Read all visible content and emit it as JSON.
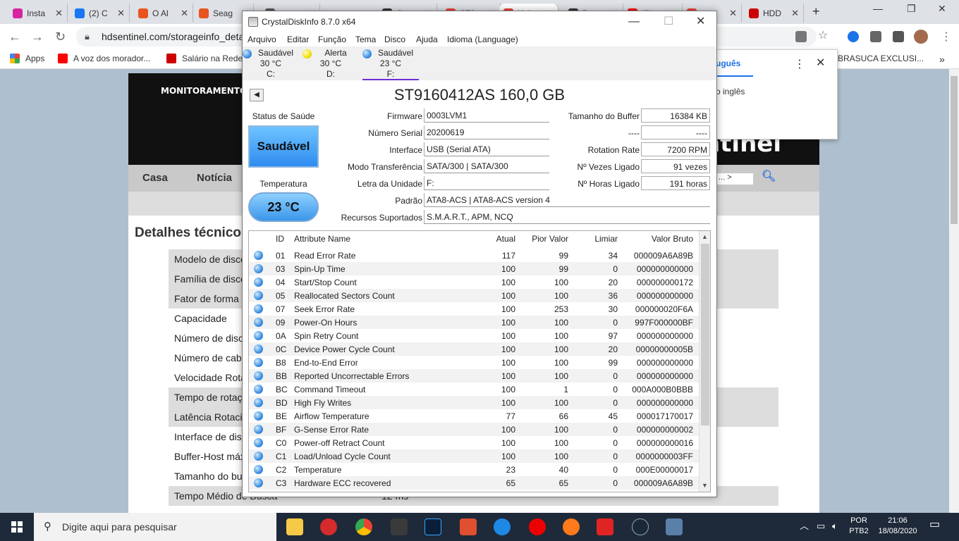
{
  "browser": {
    "tabs": [
      {
        "label": "Insta",
        "color": "#d6249f"
      },
      {
        "label": "(2) C",
        "color": "#1877f2"
      },
      {
        "label": "O Al",
        "color": "#e8541e"
      },
      {
        "label": "Seag",
        "color": "#e8541e"
      },
      {
        "label": "",
        "color": "#555"
      },
      {
        "label": "Ca",
        "color": "#333"
      },
      {
        "label": "ST9",
        "color": "#ea4335"
      },
      {
        "label": "Hel",
        "color": "#ea4335"
      },
      {
        "label": "Dat",
        "color": "#333"
      },
      {
        "label": "(3)",
        "color": "#ff0000"
      },
      {
        "label": "",
        "color": "#ea4335"
      },
      {
        "label": "HDD",
        "color": "#c00"
      }
    ],
    "url": "hdsentinel.com/storageinfo_deta",
    "bookmarks": [
      {
        "label": "Apps",
        "color": "#e94235"
      },
      {
        "label": "A voz dos morador...",
        "color": "#ff0000"
      },
      {
        "label": "Salário na Rede",
        "color": "#c00"
      },
      {
        "label": "BRASUCA EXCLUSI...",
        "color": "#fff"
      }
    ]
  },
  "translate": {
    "language": "uguês",
    "message": "o inglês"
  },
  "site": {
    "banner_title": "MONITORAMENTO DE",
    "brand": "ntinel",
    "menu": [
      "Casa",
      "Notícia"
    ],
    "search_hint": "... >",
    "heading": "Detalhes técnico",
    "details": [
      {
        "label": "Modelo de disco",
        "value": ""
      },
      {
        "label": "Família de disco",
        "value": ""
      },
      {
        "label": "Fator de forma",
        "value": ""
      },
      {
        "label": "Capacidade",
        "value": ""
      },
      {
        "label": "Número de disco",
        "value": ""
      },
      {
        "label": "Número de cabe",
        "value": ""
      },
      {
        "label": "Velocidade Rotac",
        "value": ""
      },
      {
        "label": "Tempo de rotaç",
        "value": ""
      },
      {
        "label": "Latência Rotacio",
        "value": ""
      },
      {
        "label": "Interface de disc",
        "value": ""
      },
      {
        "label": "Buffer-Host máx.",
        "value": ""
      },
      {
        "label": "Tamanho do buff",
        "value": ""
      },
      {
        "label": "Tempo Médio de Busca",
        "value": "12 ms"
      }
    ]
  },
  "cdi": {
    "title": "CrystalDiskInfo 8.7.0 x64",
    "menu": [
      "Arquivo",
      "Editar",
      "Função",
      "Tema",
      "Disco",
      "Ajuda",
      "Idioma (Language)"
    ],
    "disks": [
      {
        "status": "Saudável",
        "temp": "30 °C",
        "letter": "C:",
        "color": "blue"
      },
      {
        "status": "Alerta",
        "temp": "30 °C",
        "letter": "D:",
        "color": "yellow"
      },
      {
        "status": "Saudável",
        "temp": "23 °C",
        "letter": "F:",
        "color": "blue"
      }
    ],
    "model": "ST9160412AS 160,0 GB",
    "health_label": "Status de Saúde",
    "health": "Saudável",
    "temp_label": "Temperatura",
    "temp": "23 °C",
    "firmware_label": "Firmware",
    "firmware": "0003LVM1",
    "serial_label": "Número Serial",
    "serial": "20200619",
    "interface_label": "Interface",
    "interface": "USB (Serial ATA)",
    "transfer_label": "Modo Transferência",
    "transfer": "SATA/300 | SATA/300",
    "letter_label": "Letra da Unidade",
    "letter": "F:",
    "standard_label": "Padrão",
    "standard": "ATA8-ACS | ATA8-ACS version 4",
    "features_label": "Recursos Suportados",
    "features": "S.M.A.R.T., APM, NCQ",
    "buffer_label": "Tamanho do Buffer",
    "buffer": "16384 KB",
    "blank_label": "----",
    "blank": "----",
    "rotation_label": "Rotation Rate",
    "rotation": "7200 RPM",
    "poweron_count_label": "Nº Vezes Ligado",
    "poweron_count": "91 vezes",
    "poweron_hours_label": "Nº Horas Ligado",
    "poweron_hours": "191 horas",
    "columns": [
      "ID",
      "Attribute Name",
      "Atual",
      "Pior Valor",
      "Limiar",
      "Valor Bruto"
    ],
    "attributes": [
      [
        "01",
        "Read Error Rate",
        "117",
        "99",
        "34",
        "000009A6A89B"
      ],
      [
        "03",
        "Spin-Up Time",
        "100",
        "99",
        "0",
        "000000000000"
      ],
      [
        "04",
        "Start/Stop Count",
        "100",
        "100",
        "20",
        "000000000172"
      ],
      [
        "05",
        "Reallocated Sectors Count",
        "100",
        "100",
        "36",
        "000000000000"
      ],
      [
        "07",
        "Seek Error Rate",
        "100",
        "253",
        "30",
        "000000020F6A"
      ],
      [
        "09",
        "Power-On Hours",
        "100",
        "100",
        "0",
        "997F000000BF"
      ],
      [
        "0A",
        "Spin Retry Count",
        "100",
        "100",
        "97",
        "000000000000"
      ],
      [
        "0C",
        "Device Power Cycle Count",
        "100",
        "100",
        "20",
        "00000000005B"
      ],
      [
        "B8",
        "End-to-End Error",
        "100",
        "100",
        "99",
        "000000000000"
      ],
      [
        "BB",
        "Reported Uncorrectable Errors",
        "100",
        "100",
        "0",
        "000000000000"
      ],
      [
        "BC",
        "Command Timeout",
        "100",
        "1",
        "0",
        "000A000B0BBB"
      ],
      [
        "BD",
        "High Fly Writes",
        "100",
        "100",
        "0",
        "000000000000"
      ],
      [
        "BE",
        "Airflow Temperature",
        "77",
        "66",
        "45",
        "000017170017"
      ],
      [
        "BF",
        "G-Sense Error Rate",
        "100",
        "100",
        "0",
        "000000000002"
      ],
      [
        "C0",
        "Power-off Retract Count",
        "100",
        "100",
        "0",
        "000000000016"
      ],
      [
        "C1",
        "Load/Unload Cycle Count",
        "100",
        "100",
        "0",
        "0000000003FF"
      ],
      [
        "C2",
        "Temperature",
        "23",
        "40",
        "0",
        "000E00000017"
      ],
      [
        "C3",
        "Hardware ECC recovered",
        "65",
        "65",
        "0",
        "000009A6A89B"
      ]
    ]
  },
  "taskbar": {
    "search": "Digite aqui para pesquisar",
    "lang": "POR",
    "layout": "PTB2",
    "time": "21:06",
    "date": "18/08/2020"
  }
}
